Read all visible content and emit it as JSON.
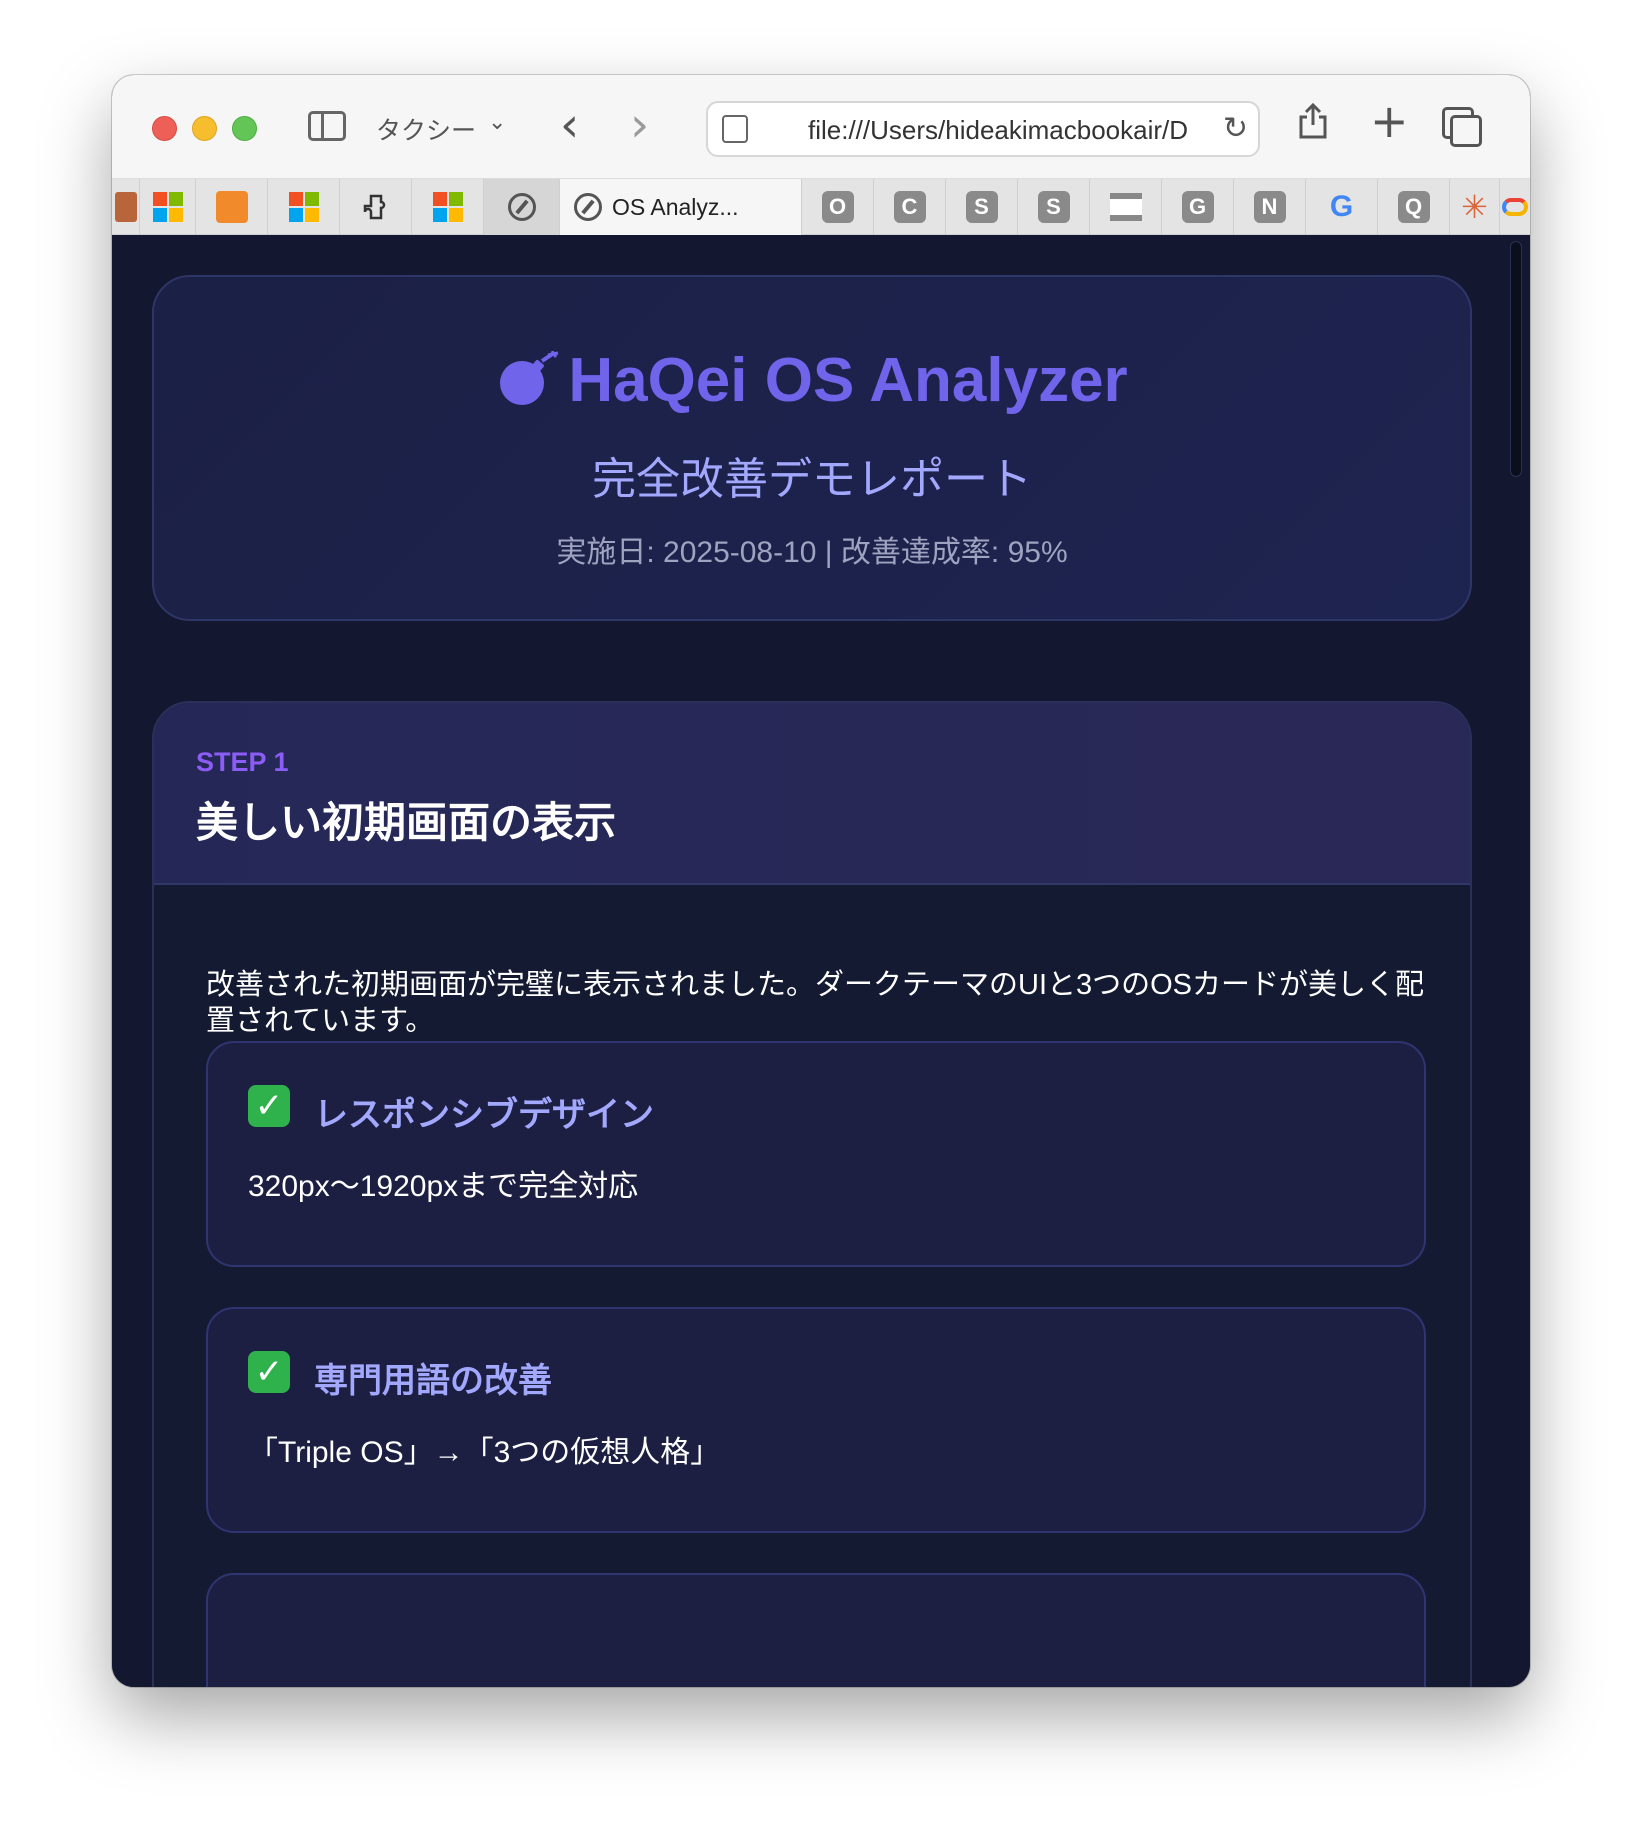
{
  "browser": {
    "tab_group": "タクシー",
    "url": "file:///Users/hideakimacbookair/D",
    "active_tab": "OS Analyz...",
    "pinned_tabs": [
      "O",
      "C",
      "S",
      "S",
      "G",
      "N",
      "G",
      "Q"
    ]
  },
  "header": {
    "title": "HaQei OS Analyzer",
    "subtitle": "完全改善デモレポート",
    "meta": "実施日: 2025-08-10 | 改善達成率: 95%"
  },
  "step1": {
    "label": "STEP 1",
    "title": "美しい初期画面の表示",
    "description": "改善された初期画面が完璧に表示されました。ダークテーマのUIと3つのOSカードが美しく配置されています。",
    "features": [
      {
        "title": "レスポンシブデザイン",
        "description": "320px〜1920pxまで完全対応"
      },
      {
        "title": "専門用語の改善",
        "description": "「Triple OS」→「3つの仮想人格」"
      }
    ]
  },
  "colors": {
    "accent": "#7064ea",
    "subtitle": "#a3a8ff",
    "step_label": "#8b5cf6",
    "background": "#131830",
    "check": "#2fb24c"
  }
}
